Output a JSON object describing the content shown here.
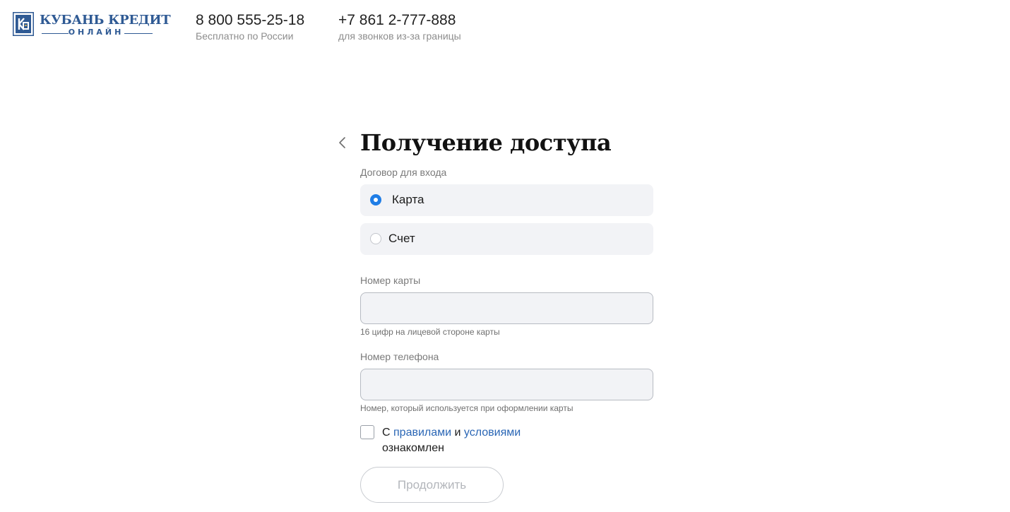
{
  "header": {
    "logo": {
      "main_text": "КУБАНЬ КРЕДИТ",
      "sub_text": "ОНЛАЙН"
    },
    "phones": [
      {
        "number": "8 800 555-25-18",
        "note": "Бесплатно по России"
      },
      {
        "number": "+7 861 2-777-888",
        "note": "для звонков из-за границы"
      }
    ]
  },
  "form": {
    "title": "Получение доступа",
    "contract_label": "Договор для входа",
    "contract_options": [
      {
        "label": "Карта",
        "selected": true
      },
      {
        "label": "Счет",
        "selected": false
      }
    ],
    "card_number": {
      "label": "Номер карты",
      "value": "",
      "hint": "16 цифр на лицевой стороне карты"
    },
    "phone_number": {
      "label": "Номер телефона",
      "value": "",
      "hint": "Номер, который используется при оформлении карты"
    },
    "consent": {
      "prefix": "С ",
      "rules_link": "правилами",
      "conjunction": " и ",
      "terms_link": "условиями",
      "suffix": " ознакомлен",
      "checked": false
    },
    "continue_label": "Продолжить"
  },
  "colors": {
    "brand": "#2f5a94",
    "accent": "#1f7de6",
    "link": "#2a66b5",
    "field_background": "#f2f3f6",
    "disabled_text": "#b3b6bb"
  },
  "icons": {
    "back": "chevron-left-icon",
    "logo": "kuban-kredit-logo-icon"
  }
}
